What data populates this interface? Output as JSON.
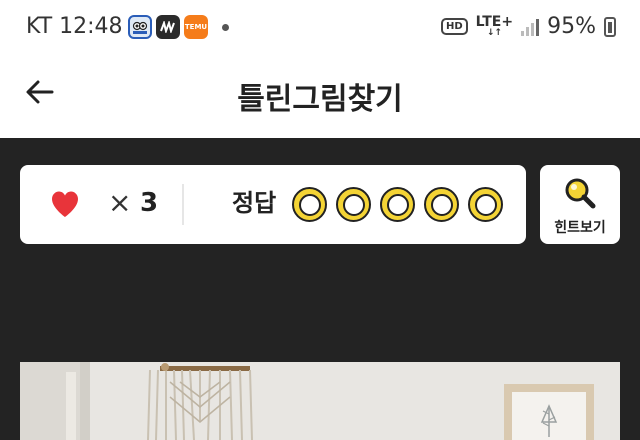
{
  "status_bar": {
    "time": "KT 12:48",
    "notification_icons": [
      "game-mascot-icon",
      "news-app-icon",
      "temu-app-icon"
    ],
    "app_icon_labels": {
      "temu": "TEMU"
    },
    "hd_label": "HD",
    "network_label": "LTE+",
    "battery_percent": "95%"
  },
  "header": {
    "title": "틀린그림찾기",
    "back_icon": "arrow-left-icon"
  },
  "score_panel": {
    "heart_icon": "heart-icon",
    "times_symbol": "×",
    "lives": "3",
    "answer_label": "정답",
    "answer_slots_total": 5,
    "answer_slots_found": 0
  },
  "hint_button": {
    "label": "힌트보기",
    "icon": "magnifier-icon"
  },
  "colors": {
    "background": "#232323",
    "heart": "#e8343a",
    "slot_yellow": "#f4d435",
    "panel": "#ffffff"
  }
}
